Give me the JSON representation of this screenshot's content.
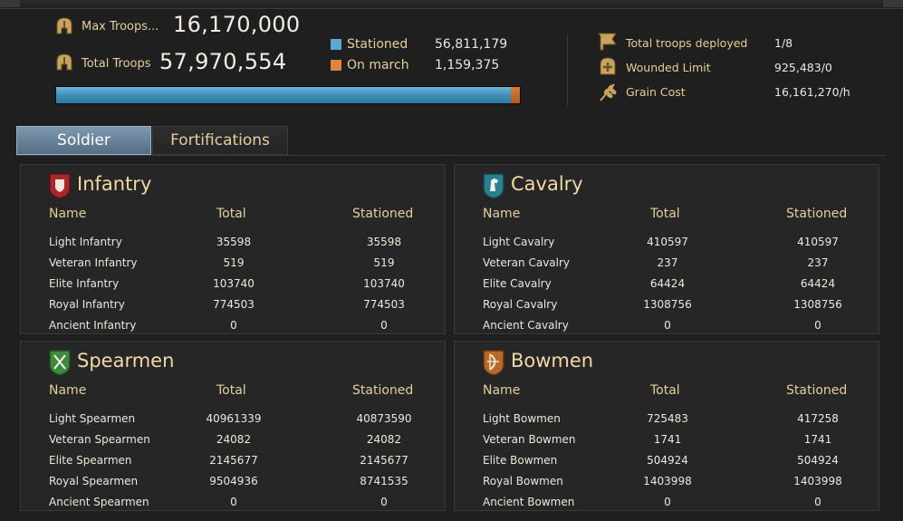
{
  "header": {
    "max_troops_label": "Max Troops...",
    "max_troops_value": "16,170,000",
    "total_troops_label": "Total Troops",
    "total_troops_value": "57,970,554",
    "legend": [
      {
        "label": "Stationed",
        "value": "56,811,179",
        "color": "#5aa9d3"
      },
      {
        "label": "On march",
        "value": "1,159,375",
        "color": "#e0843f"
      }
    ],
    "bar": {
      "stationed_fraction": 0.98,
      "march_fraction": 0.02
    },
    "right_stats": [
      {
        "icon": "flag-icon",
        "label": "Total troops deployed",
        "value": "1/8"
      },
      {
        "icon": "wounded-icon",
        "label": "Wounded Limit",
        "value": "925,483/0"
      },
      {
        "icon": "grain-icon",
        "label": "Grain Cost",
        "value": "16,161,270/h"
      }
    ]
  },
  "tabs": [
    {
      "label": "Soldier",
      "active": true
    },
    {
      "label": "Fortifications",
      "active": false
    }
  ],
  "columns": {
    "name": "Name",
    "total": "Total",
    "stationed": "Stationed"
  },
  "panels": [
    {
      "title": "Infantry",
      "icon": "infantry-shield-icon",
      "color": "#a8282c",
      "rows": [
        {
          "name": "Light Infantry",
          "total": "35598",
          "stationed": "35598"
        },
        {
          "name": "Veteran Infantry",
          "total": "519",
          "stationed": "519"
        },
        {
          "name": "Elite Infantry",
          "total": "103740",
          "stationed": "103740"
        },
        {
          "name": "Royal Infantry",
          "total": "774503",
          "stationed": "774503"
        },
        {
          "name": "Ancient Infantry",
          "total": "0",
          "stationed": "0"
        }
      ]
    },
    {
      "title": "Cavalry",
      "icon": "cavalry-horse-icon",
      "color": "#2b7f8e",
      "rows": [
        {
          "name": "Light Cavalry",
          "total": "410597",
          "stationed": "410597"
        },
        {
          "name": "Veteran Cavalry",
          "total": "237",
          "stationed": "237"
        },
        {
          "name": "Elite Cavalry",
          "total": "64424",
          "stationed": "64424"
        },
        {
          "name": "Royal Cavalry",
          "total": "1308756",
          "stationed": "1308756"
        },
        {
          "name": "Ancient Cavalry",
          "total": "0",
          "stationed": "0"
        }
      ]
    },
    {
      "title": "Spearmen",
      "icon": "spearmen-crossed-spears-icon",
      "color": "#3e8a3c",
      "rows": [
        {
          "name": "Light Spearmen",
          "total": "40961339",
          "stationed": "40873590"
        },
        {
          "name": "Veteran Spearmen",
          "total": "24082",
          "stationed": "24082"
        },
        {
          "name": "Elite Spearmen",
          "total": "2145677",
          "stationed": "2145677"
        },
        {
          "name": "Royal Spearmen",
          "total": "9504936",
          "stationed": "8741535"
        },
        {
          "name": "Ancient Spearmen",
          "total": "0",
          "stationed": "0"
        }
      ]
    },
    {
      "title": "Bowmen",
      "icon": "bowmen-bow-icon",
      "color": "#b8692a",
      "rows": [
        {
          "name": "Light Bowmen",
          "total": "725483",
          "stationed": "417258"
        },
        {
          "name": "Veteran Bowmen",
          "total": "1741",
          "stationed": "1741"
        },
        {
          "name": "Elite Bowmen",
          "total": "504924",
          "stationed": "504924"
        },
        {
          "name": "Royal Bowmen",
          "total": "1403998",
          "stationed": "1403998"
        },
        {
          "name": "Ancient Bowmen",
          "total": "0",
          "stationed": "0"
        }
      ]
    }
  ]
}
